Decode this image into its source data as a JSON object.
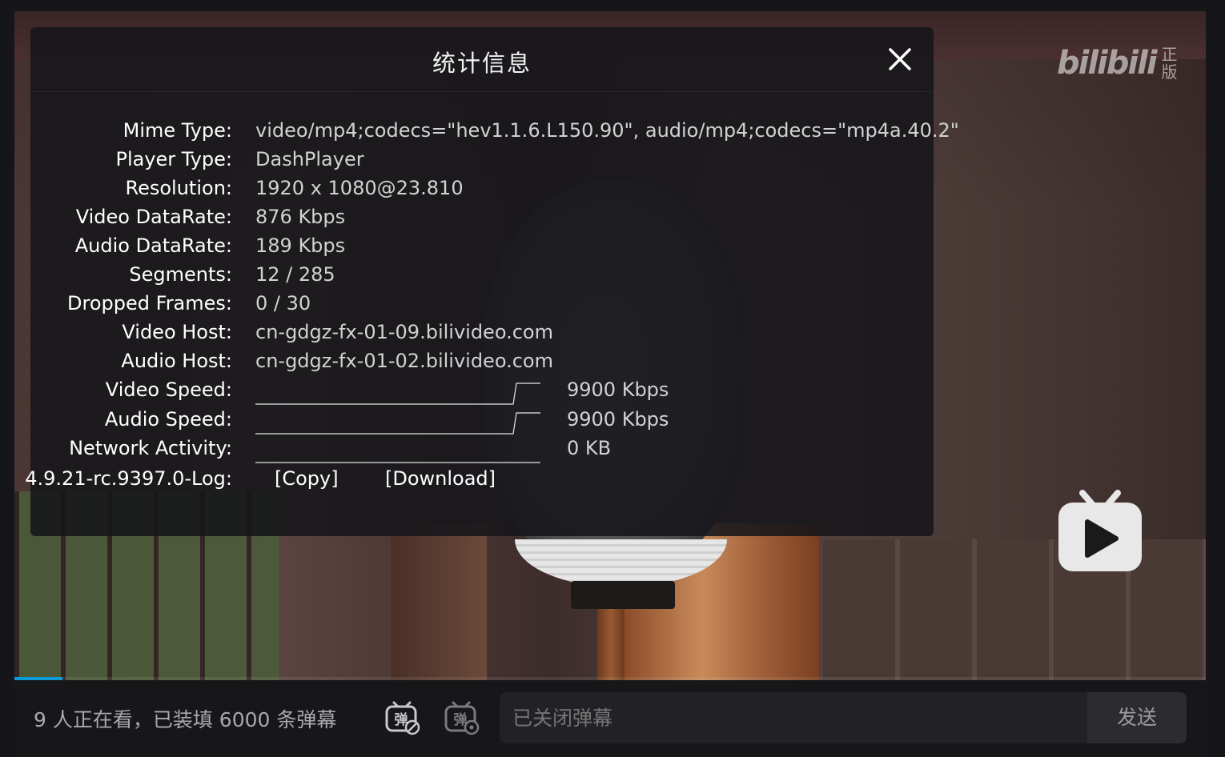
{
  "player": {
    "progress_fraction": 0.04,
    "watermark": {
      "logo_text": "bilibili",
      "badge": "正版"
    }
  },
  "stats": {
    "title": "统计信息",
    "rows": [
      {
        "label": "Mime Type:",
        "value": "video/mp4;codecs=\"hev1.1.6.L150.90\", audio/mp4;codecs=\"mp4a.40.2\""
      },
      {
        "label": "Player Type:",
        "value": "DashPlayer"
      },
      {
        "label": "Resolution:",
        "value": "1920 x 1080@23.810"
      },
      {
        "label": "Video DataRate:",
        "value": "876 Kbps"
      },
      {
        "label": "Audio DataRate:",
        "value": "189 Kbps"
      },
      {
        "label": "Segments:",
        "value": "12 / 285"
      },
      {
        "label": "Dropped Frames:",
        "value": "0 / 30"
      },
      {
        "label": "Video Host:",
        "value": "cn-gdgz-fx-01-09.bilivideo.com"
      },
      {
        "label": "Audio Host:",
        "value": "cn-gdgz-fx-01-02.bilivideo.com"
      }
    ],
    "graphs": [
      {
        "label": "Video Speed:",
        "value": "9900 Kbps"
      },
      {
        "label": "Audio Speed:",
        "value": "9900 Kbps"
      },
      {
        "label": "Network Activity:",
        "value": "0 KB"
      }
    ],
    "log": {
      "label": "4.9.21-rc.9397.0-Log:",
      "copy": "[Copy]",
      "download": "[Download]"
    }
  },
  "bottom": {
    "viewers_text": "9 人正在看，已装填 6000 条弹幕",
    "danmaku_placeholder": "已关闭弹幕",
    "send_label": "发送"
  },
  "colors": {
    "accent": "#0c9bd4",
    "panel_bg": "#16161a"
  },
  "icons": [
    "close-icon",
    "danmaku-toggle-icon",
    "danmaku-settings-icon",
    "tv-play-icon"
  ]
}
